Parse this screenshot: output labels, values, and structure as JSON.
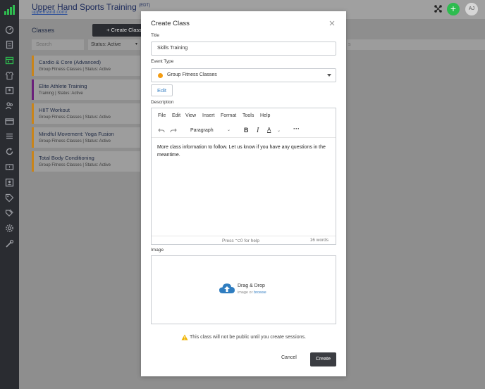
{
  "app": {
    "title": "Upper Hand Sports Training",
    "title_suffix": "(EDT)",
    "url": "upperhand.com/",
    "avatar_initials": "AJ",
    "add_label": "+"
  },
  "classes_panel": {
    "heading": "Classes",
    "create_label": "+ Create Class",
    "search_placeholder": "Search",
    "status_filter": "Status: Active",
    "right_placeholder": "s",
    "items": [
      {
        "name": "Cardio & Core (Advanced)",
        "meta": "Group Fitness Classes | Status: Active",
        "accent": "#c9841a"
      },
      {
        "name": "Elite Athlete Training",
        "meta": "Training | Status: Active",
        "accent": "#6a1f7a"
      },
      {
        "name": "HIIT Workout",
        "meta": "Group Fitness Classes | Status: Active",
        "accent": "#c9841a"
      },
      {
        "name": "Mindful Movement: Yoga Fusion",
        "meta": "Group Fitness Classes | Status: Active",
        "accent": "#c9841a"
      },
      {
        "name": "Total Body Conditioning",
        "meta": "Group Fitness Classes | Status: Active",
        "accent": "#c9841a"
      }
    ]
  },
  "modal": {
    "title": "Create Class",
    "title_label": "Title",
    "title_value": "Skills Training",
    "event_type_label": "Event Type",
    "event_type_value": "Group Fitness Classes",
    "event_type_color": "#f39c12",
    "edit_label": "Edit",
    "description_label": "Description",
    "menu": [
      "File",
      "Edit",
      "View",
      "Insert",
      "Format",
      "Tools",
      "Help"
    ],
    "block_format": "Paragraph",
    "description_text": "More class information to follow. Let us know if you have any questions in the meantime.",
    "help_text": "Press ⌥0 for help",
    "word_count": "16 words",
    "image_label": "Image",
    "drop_title": "Drag & Drop",
    "drop_sub_prefix": "image or",
    "drop_sub_link": "browse",
    "warning": "This class will not be public until you create sessions.",
    "cancel_label": "Cancel",
    "create_label": "Create"
  }
}
